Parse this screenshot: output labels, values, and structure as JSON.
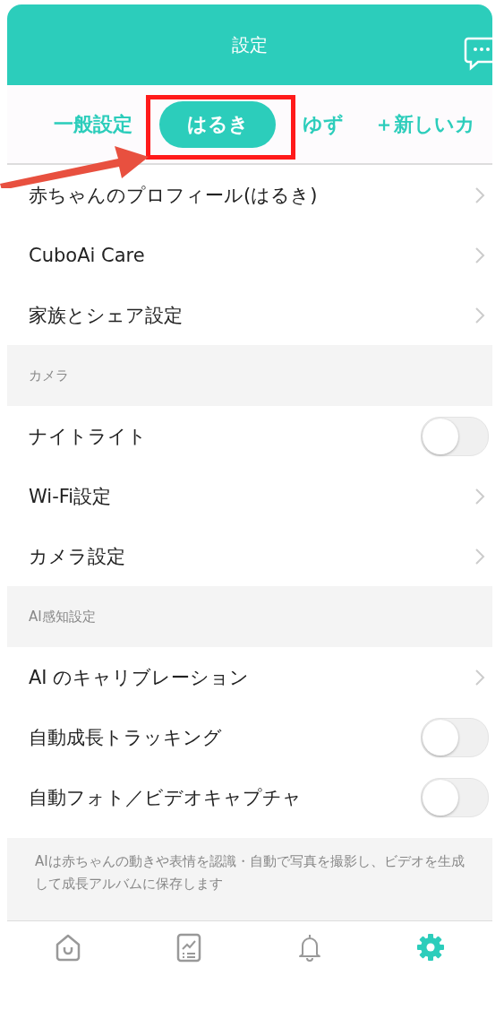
{
  "header": {
    "title": "設定"
  },
  "tabs": [
    {
      "label": "一般設定",
      "selected": false
    },
    {
      "label": "はるき",
      "selected": true
    },
    {
      "label": "ゆず",
      "selected": false
    },
    {
      "label": "＋新しいカ",
      "selected": false
    }
  ],
  "sections": [
    {
      "rows": [
        {
          "kind": "link",
          "label": "赤ちゃんのプロフィール(はるき)"
        },
        {
          "kind": "link",
          "label": "CuboAi Care"
        },
        {
          "kind": "link",
          "label": "家族とシェア設定"
        }
      ]
    },
    {
      "title": "カメラ",
      "rows": [
        {
          "kind": "toggle",
          "label": "ナイトライト",
          "on": false
        },
        {
          "kind": "link",
          "label": "Wi-Fi設定"
        },
        {
          "kind": "link",
          "label": "カメラ設定"
        }
      ]
    },
    {
      "title": "AI感知設定",
      "rows": [
        {
          "kind": "link",
          "label": "AI のキャリブレーション"
        },
        {
          "kind": "toggle",
          "label": "自動成長トラッキング",
          "on": false
        },
        {
          "kind": "toggle",
          "label": "自動フォト／ビデオキャプチャ",
          "on": false
        }
      ],
      "note": "AIは赤ちゃんの動きや表情を認識・自動で写真を撮影し、ビデオを生成して成長アルバムに保存します"
    }
  ],
  "tab_bar": [
    {
      "kind": "home",
      "selected": false
    },
    {
      "kind": "chart",
      "selected": false
    },
    {
      "kind": "bell",
      "selected": false
    },
    {
      "kind": "gear",
      "selected": true
    }
  ]
}
